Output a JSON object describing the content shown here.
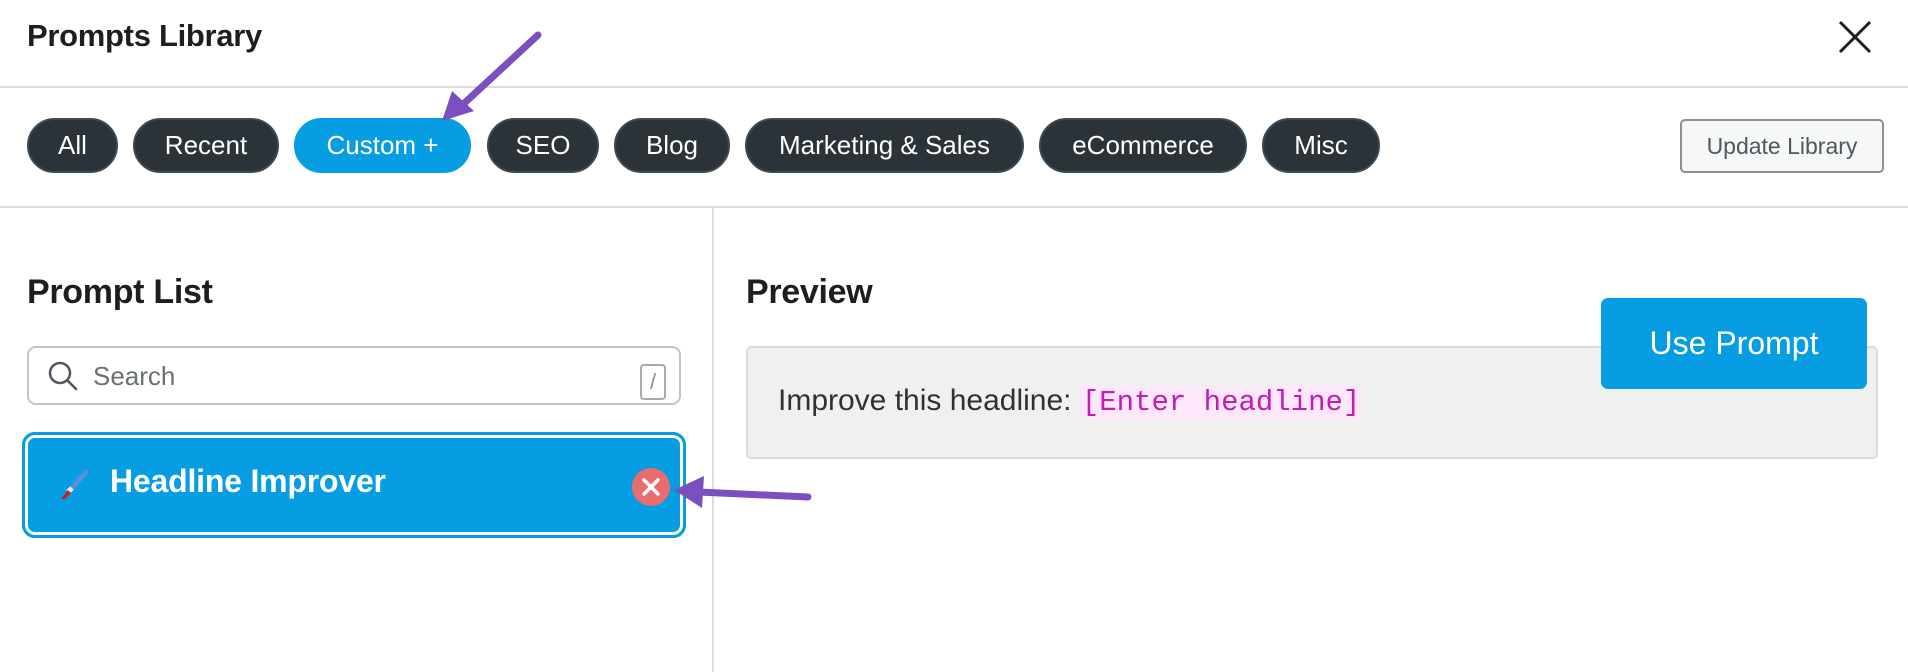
{
  "header": {
    "title": "Prompts Library",
    "close_icon": "close-icon"
  },
  "tabs": [
    {
      "label": "All",
      "active": false
    },
    {
      "label": "Recent",
      "active": false
    },
    {
      "label": "Custom +",
      "active": true
    },
    {
      "label": "SEO",
      "active": false
    },
    {
      "label": "Blog",
      "active": false
    },
    {
      "label": "Marketing & Sales",
      "active": false
    },
    {
      "label": "eCommerce",
      "active": false
    },
    {
      "label": "Misc",
      "active": false
    }
  ],
  "update_button": {
    "label": "Update Library"
  },
  "prompt_list": {
    "title": "Prompt List",
    "search": {
      "placeholder": "Search",
      "value": "",
      "shortcut": "/"
    },
    "items": [
      {
        "label": "Headline Improver",
        "icon": "paintbrush-icon",
        "selected": true
      }
    ]
  },
  "preview": {
    "title": "Preview",
    "text": "Improve this headline: ",
    "placeholder_token": "[Enter headline]"
  },
  "use_button": {
    "label": "Use Prompt"
  },
  "annotations": {
    "arrow_color": "#7b4fbf"
  },
  "colors": {
    "accent": "#069de3",
    "tab_bg": "#2c3338",
    "remove": "#e96d6d",
    "token": "#c11bb8"
  }
}
